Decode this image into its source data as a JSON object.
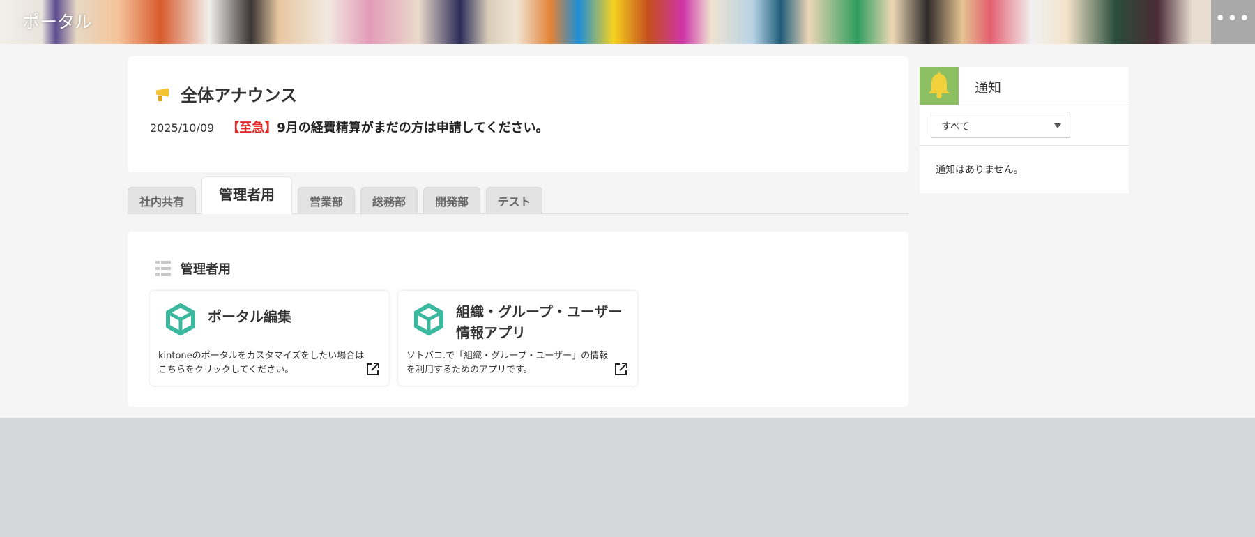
{
  "header": {
    "title": "ポータル",
    "more_label": "•••"
  },
  "announcement": {
    "title": "全体アナウンス",
    "date": "2025/10/09",
    "urgent_tag": "【至急】",
    "message": "9月の経費精算がまだの方は申請してください。",
    "icon": "megaphone-icon"
  },
  "tabs": [
    {
      "label": "社内共有",
      "active": false
    },
    {
      "label": "管理者用",
      "active": true
    },
    {
      "label": "営業部",
      "active": false
    },
    {
      "label": "総務部",
      "active": false
    },
    {
      "label": "開発部",
      "active": false
    },
    {
      "label": "テスト",
      "active": false
    }
  ],
  "apps_section": {
    "title": "管理者用",
    "icon": "list-icon",
    "cards": [
      {
        "name": "ポータル編集",
        "description": "kintoneのポータルをカスタマイズをしたい場合はこちらをクリックしてください。",
        "icon": "app-cube-icon"
      },
      {
        "name": "組織・グループ・ユーザー情報アプリ",
        "description": "ソトバコ.で「組織・グループ・ユーザー」の情報を利用するためのアプリです。",
        "icon": "app-cube-icon"
      }
    ]
  },
  "notifications": {
    "title": "通知",
    "filter_value": "すべて",
    "empty_text": "通知はありません。",
    "icon": "bell-icon"
  },
  "colors": {
    "urgent": "#e02a2a",
    "bell_bg": "#8cc063",
    "app_icon": "#3bb89e"
  }
}
